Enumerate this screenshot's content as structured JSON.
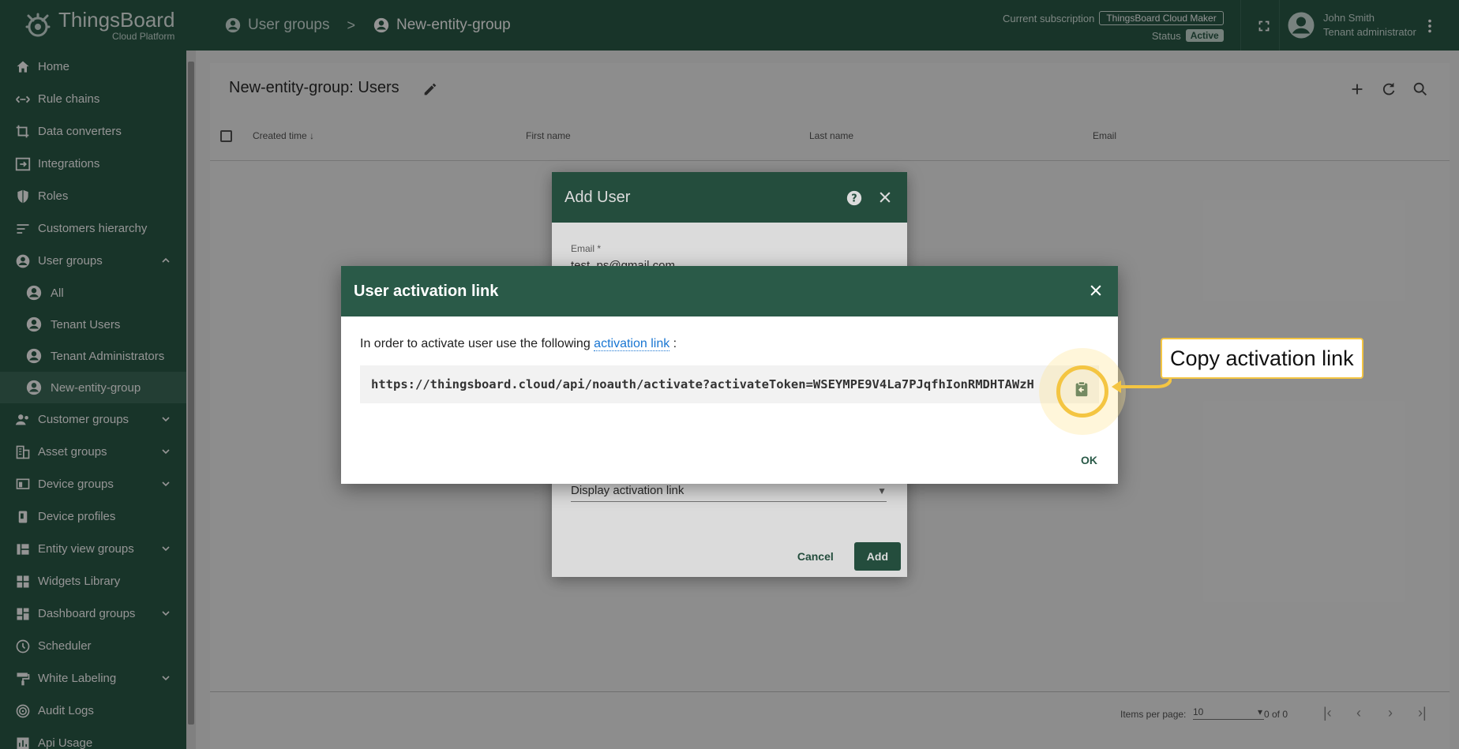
{
  "app": {
    "name": "ThingsBoard",
    "sub": "Cloud Platform"
  },
  "breadcrumb": [
    {
      "label": "User groups"
    },
    {
      "label": "New-entity-group"
    }
  ],
  "breadcrumb_sep": ">",
  "subscription": {
    "label": "Current subscription",
    "plan": "ThingsBoard Cloud Maker",
    "status_label": "Status",
    "status": "Active"
  },
  "user": {
    "name": "John Smith",
    "role": "Tenant administrator"
  },
  "sidebar": {
    "items": [
      {
        "label": "Home",
        "icon": "home-icon"
      },
      {
        "label": "Rule chains",
        "icon": "rule-chain-icon"
      },
      {
        "label": "Data converters",
        "icon": "converter-icon"
      },
      {
        "label": "Integrations",
        "icon": "integration-icon"
      },
      {
        "label": "Roles",
        "icon": "shield-icon"
      },
      {
        "label": "Customers hierarchy",
        "icon": "hierarchy-icon"
      },
      {
        "label": "User groups",
        "icon": "account-icon",
        "expanded": true
      },
      {
        "label": "Customer groups",
        "icon": "customers-icon"
      },
      {
        "label": "Asset groups",
        "icon": "asset-icon"
      },
      {
        "label": "Device groups",
        "icon": "device-icon"
      },
      {
        "label": "Device profiles",
        "icon": "device-profile-icon"
      },
      {
        "label": "Entity view groups",
        "icon": "entity-view-icon"
      },
      {
        "label": "Widgets Library",
        "icon": "widgets-icon"
      },
      {
        "label": "Dashboard groups",
        "icon": "dashboard-icon"
      },
      {
        "label": "Scheduler",
        "icon": "clock-icon"
      },
      {
        "label": "White Labeling",
        "icon": "paint-roller-icon"
      },
      {
        "label": "Audit Logs",
        "icon": "audit-icon"
      },
      {
        "label": "Api Usage",
        "icon": "api-usage-icon"
      }
    ],
    "user_group_children": [
      {
        "label": "All"
      },
      {
        "label": "Tenant Users"
      },
      {
        "label": "Tenant Administrators"
      },
      {
        "label": "New-entity-group",
        "selected": true
      }
    ]
  },
  "main": {
    "title": "New-entity-group: Users",
    "columns": [
      "Created time",
      "First name",
      "Last name",
      "Email"
    ],
    "footer": {
      "items_per_page_label": "Items per page:",
      "items_per_page": "10",
      "range": "0 of 0"
    }
  },
  "add_user_dialog": {
    "title": "Add User",
    "email_label": "Email *",
    "email_value": "test_ps@gmail.com",
    "activation_method": "Display activation link",
    "cancel_label": "Cancel",
    "add_label": "Add"
  },
  "activation_dialog": {
    "title": "User activation link",
    "text_before": "In order to activate user use the following",
    "link_text": "activation link",
    "text_after": ":",
    "url": "https://thingsboard.cloud/api/noauth/activate?activateToken=WSEYMPE9V4La7PJqfhIonRMDHTAWzH",
    "ok_label": "OK"
  },
  "callout": {
    "text": "Copy activation link"
  },
  "colors": {
    "primary": "#2a5a48",
    "highlight": "#f4c542",
    "link": "#1976d2"
  }
}
